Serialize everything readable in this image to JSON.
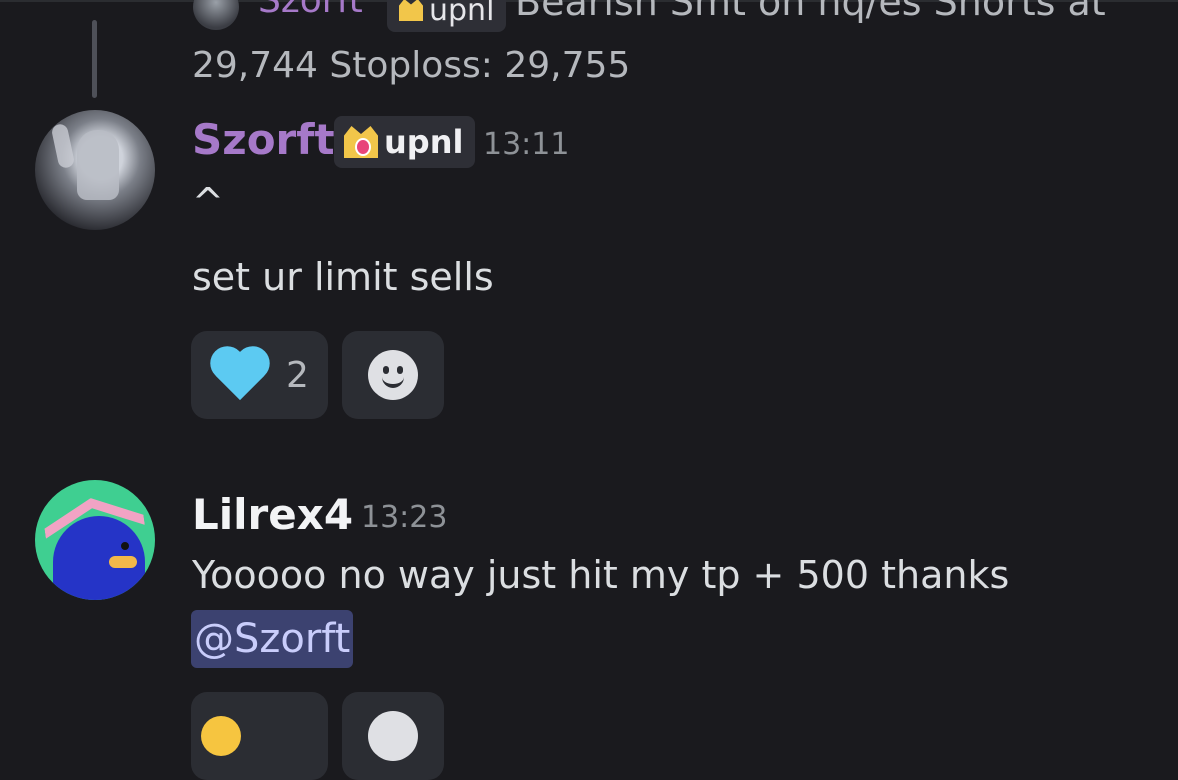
{
  "reply_preview": {
    "author": "Szorft",
    "badge": "upnl",
    "text_line1": "Bearish Smt on nq/es  Shorts at",
    "text_line2": "29,744  Stoploss: 29,755"
  },
  "messages": [
    {
      "author": "Szorft",
      "author_color": "#a679c9",
      "badge": "upnl",
      "time": "13:11",
      "lines": [
        "^",
        "set ur limit sells"
      ],
      "reactions": [
        {
          "emoji": "light-blue-heart-icon",
          "count": "2"
        },
        {
          "emoji": "add-reaction-icon"
        }
      ]
    },
    {
      "author": "Lilrex4",
      "author_color": "#f2f3f5",
      "time": "13:23",
      "lines": [
        "Yooooo no way just hit my tp + 500 thanks"
      ],
      "mention": "@Szorft"
    }
  ],
  "colors": {
    "background": "#1a1a1e",
    "mention_bg": "#3c4270",
    "reaction_bg": "#2b2d33"
  }
}
